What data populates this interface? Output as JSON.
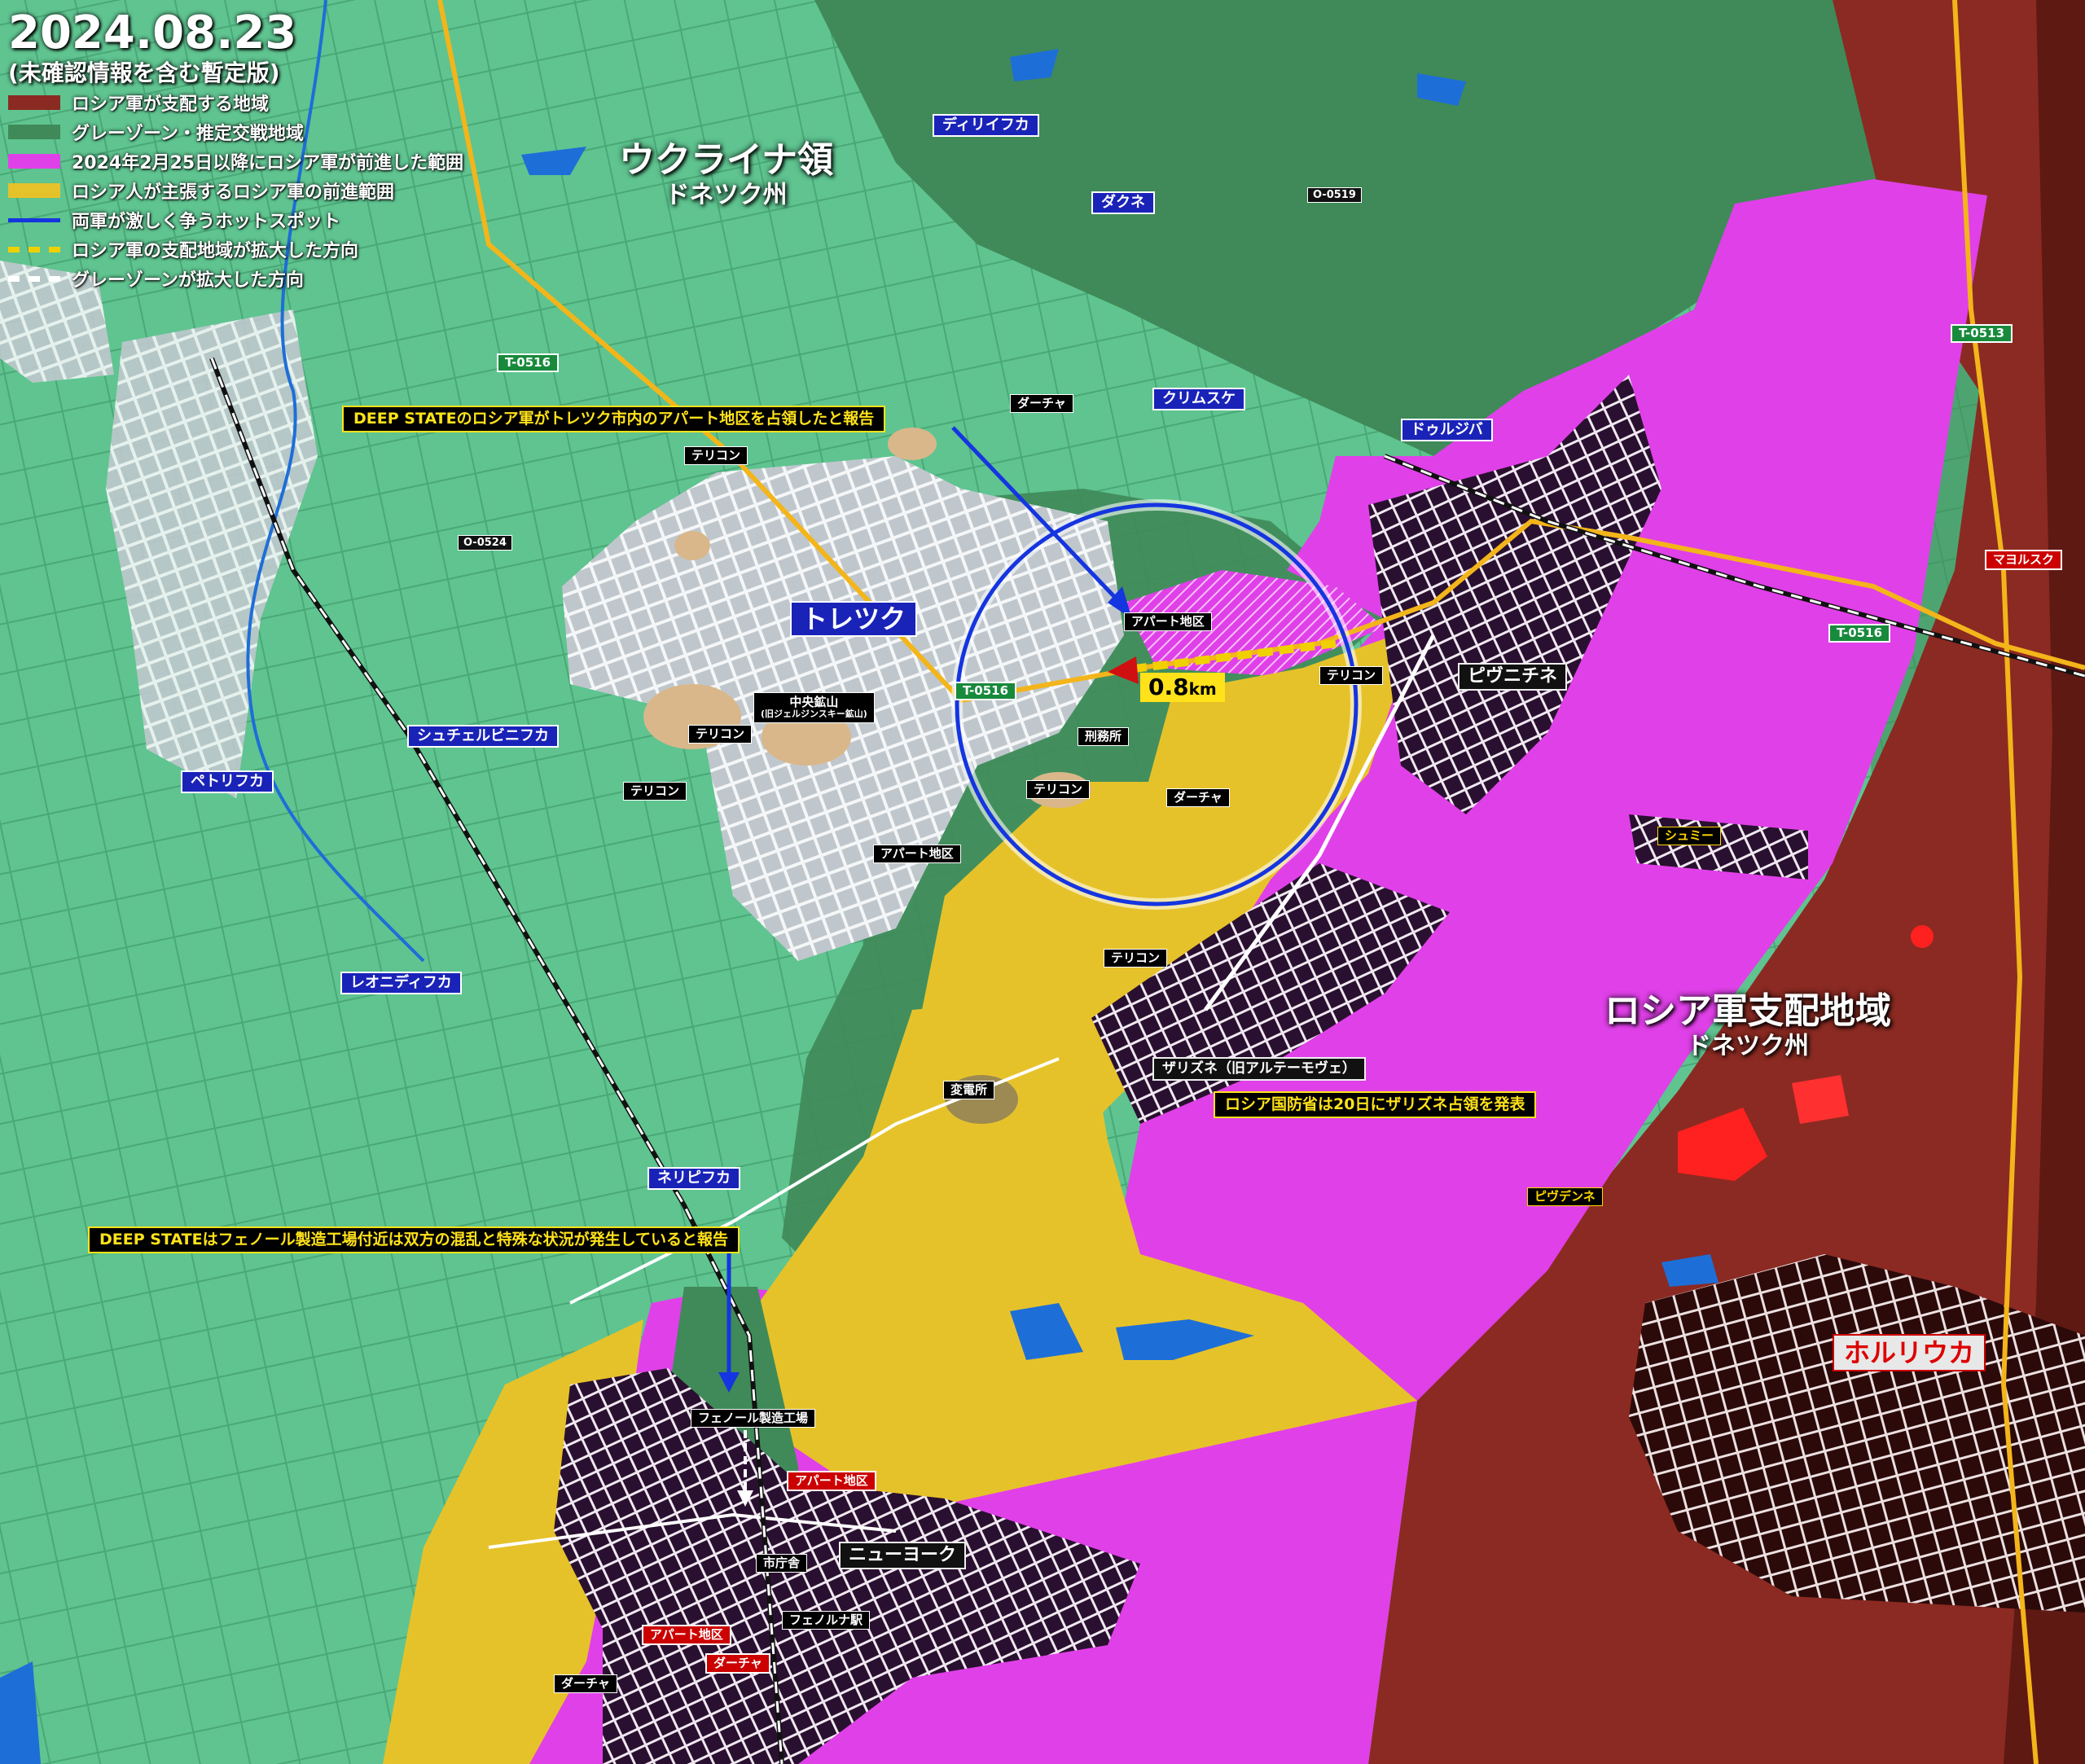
{
  "date": "2024.08.23",
  "subtitle": "(未確認情報を含む暫定版)",
  "legend": [
    {
      "label": "ロシア軍が支配する地域",
      "color": "#8b2a22"
    },
    {
      "label": "グレーゾーン・推定交戦地域",
      "color": "#3f8a58"
    },
    {
      "label": "2024年2月25日以降にロシア軍が前進した範囲",
      "color": "#e040e8"
    },
    {
      "label": "ロシア人が主張するロシア軍の前進範囲",
      "color": "#e6c22a"
    },
    {
      "label": "両軍が激しく争うホットスポット",
      "color": "#1535e0"
    },
    {
      "label": "ロシア軍の支配地域が拡大した方向",
      "color": "#f0d000"
    },
    {
      "label": "グレーゾーンが拡大した方向",
      "color": "#ffffff"
    }
  ],
  "regions": {
    "ukraine_title": "ウクライナ領",
    "ukraine_sub": "ドネツク州",
    "russia_title": "ロシア軍支配地域",
    "russia_sub": "ドネツク州"
  },
  "callouts": {
    "toretsk_apartments": "DEEP STATEのロシア軍がトレツク市内のアパート地区を占領したと報告",
    "phenol_plant": "DEEP STATEはフェノール製造工場付近は双方の混乱と特殊な状況が発生していると報告",
    "zalizne": "ロシア国防省は20日にザリズネ占領を発表"
  },
  "distance": {
    "value": "0.8",
    "unit": "km"
  },
  "places": {
    "toretsk": "トレツク",
    "shcherbynivka": "シュチェルビニフカ",
    "petrivka": "ペトリフカ",
    "leonidivka": "レオニディフカ",
    "nelipivka": "ネリピフカ",
    "dyliivka": "ディリイフカ",
    "dachne": "ダクネ",
    "krymske": "クリムスケ",
    "druzhba": "ドゥルジバ",
    "pivnichne": "ピヴニチネ",
    "newyork": "ニューヨーク",
    "horlivka": "ホルリウカ",
    "zalizne": "ザリズネ（旧アルテーモヴェ）",
    "pivdenne": "ピヴデンネ",
    "shumy": "シュミー",
    "mayorsk": "マヨルスク"
  },
  "small_labels": {
    "dacha1": "ダーチャ",
    "dacha2": "ダーチャ",
    "dacha3": "ダーチャ",
    "dacha4": "ダーチャ",
    "terikon1": "テリコン",
    "terikon2": "テリコン",
    "terikon3": "テリコン",
    "terikon4": "テリコン",
    "terikon5": "テリコン",
    "terikon6": "テリコン",
    "apartments1": "アパート地区",
    "apartments2": "アパート地区",
    "apartments3": "アパート地区",
    "apartments4": "アパート地区",
    "central_mine": "中央鉱山",
    "central_mine_sub": "(旧ジェルジンスキー鉱山)",
    "prison": "刑務所",
    "substation": "変電所",
    "phenol_plant": "フェノール製造工場",
    "city_hall": "市庁舎",
    "phenolna_station": "フェノルナ駅"
  },
  "roads": {
    "t0516_a": "T-0516",
    "t0516_b": "T-0516",
    "t0516_c": "T-0516",
    "t0513": "T-0513",
    "o0519": "O-0519",
    "o0524": "O-0524"
  },
  "colors": {
    "ukraine_green": "#5fc490",
    "grey_zone": "#3f8a58",
    "russia_controlled": "#8b2a22",
    "advance_magenta": "#e040e8",
    "claimed_yellow": "#e6c22a",
    "hotspot_blue": "#1535e0"
  }
}
